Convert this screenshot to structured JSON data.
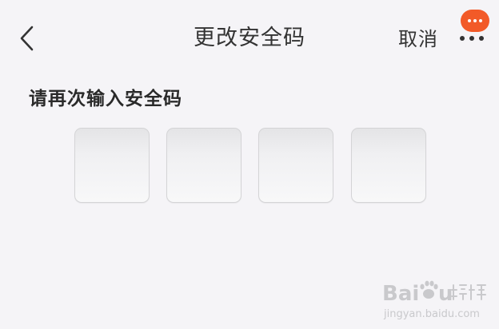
{
  "header": {
    "title": "更改安全码",
    "back_icon": "chevron-left-icon",
    "cancel_label": "取消",
    "more_icon": "more-horizontal-icon",
    "badge_color": "#f25a28"
  },
  "prompt": {
    "text": "请再次输入安全码"
  },
  "code_input": {
    "length": 4,
    "values": [
      "",
      "",
      "",
      ""
    ]
  },
  "watermark": {
    "url": "jingyan.baidu.com"
  },
  "colors": {
    "background": "#f5f4f7",
    "text": "#333333",
    "accent": "#f25a28"
  }
}
